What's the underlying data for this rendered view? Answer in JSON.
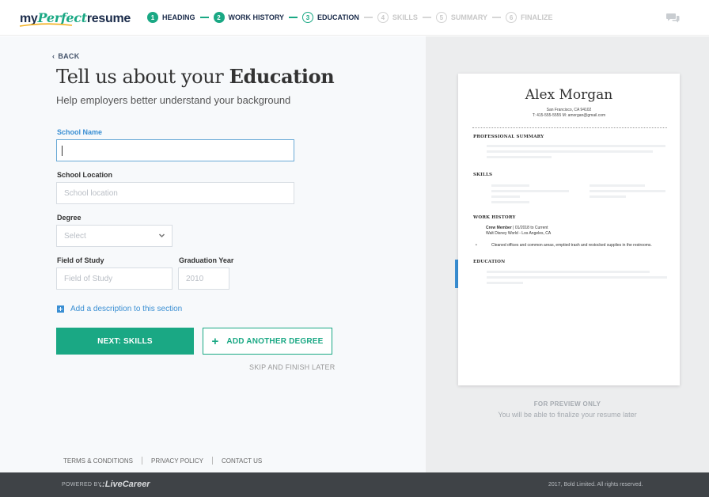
{
  "brand": {
    "my": "my",
    "perfect": "Perfect",
    "resume": "resume"
  },
  "steps": [
    {
      "num": "1",
      "label": "HEADING",
      "state": "done"
    },
    {
      "num": "2",
      "label": "WORK HISTORY",
      "state": "done"
    },
    {
      "num": "3",
      "label": "EDUCATION",
      "state": "current"
    },
    {
      "num": "4",
      "label": "SKILLS",
      "state": "todo"
    },
    {
      "num": "5",
      "label": "SUMMARY",
      "state": "todo"
    },
    {
      "num": "6",
      "label": "FINALIZE",
      "state": "todo"
    }
  ],
  "chat_icon": "chat-bubbles-icon",
  "form": {
    "back_label": "BACK",
    "title_prefix": "Tell us about your ",
    "title_bold": "Education",
    "subtitle": "Help employers better understand your background",
    "school_name": {
      "label": "School Name",
      "value": ""
    },
    "school_location": {
      "label": "School Location",
      "placeholder": "School location"
    },
    "degree": {
      "label": "Degree",
      "placeholder": "Select"
    },
    "field_of_study": {
      "label": "Field of Study",
      "placeholder": "Field of Study"
    },
    "graduation_year": {
      "label": "Graduation Year",
      "placeholder": "2010"
    },
    "add_description": "Add a description to this section",
    "next_button": "NEXT: SKILLS",
    "add_degree_button": "ADD ANOTHER DEGREE",
    "skip": "SKIP AND FINISH LATER"
  },
  "footer_links": [
    "TERMS & CONDITIONS",
    "PRIVACY POLICY",
    "CONTACT US"
  ],
  "preview": {
    "name": "Alex Morgan",
    "address": "San Francisco, CA 94102",
    "contact": "T: 415-555-5555 M: amorgan@gmail.com",
    "sections": {
      "summary": "PROFESSIONAL SUMMARY",
      "skills": "SKILLS",
      "work": "WORK HISTORY",
      "education": "EDUCATION"
    },
    "job_title": "Crew Member",
    "job_dates": "01/2018 to Current",
    "job_company": "Walt Disney World - Los Angeles, CA",
    "job_bullet": "Cleaned offices and common areas, emptied trash and restocked supplies in the restrooms.",
    "label": "FOR PREVIEW ONLY",
    "note": "You will be able to finalize your resume later"
  },
  "bottom": {
    "powered": "POWERED BY",
    "livecareer": ".:LiveCareer",
    "copyright": "2017, Bold Limited. All rights reserved."
  },
  "colors": {
    "accent": "#1aa884",
    "link": "#3a8fd3",
    "navy": "#1a2b4a",
    "footer": "#3f4347"
  }
}
